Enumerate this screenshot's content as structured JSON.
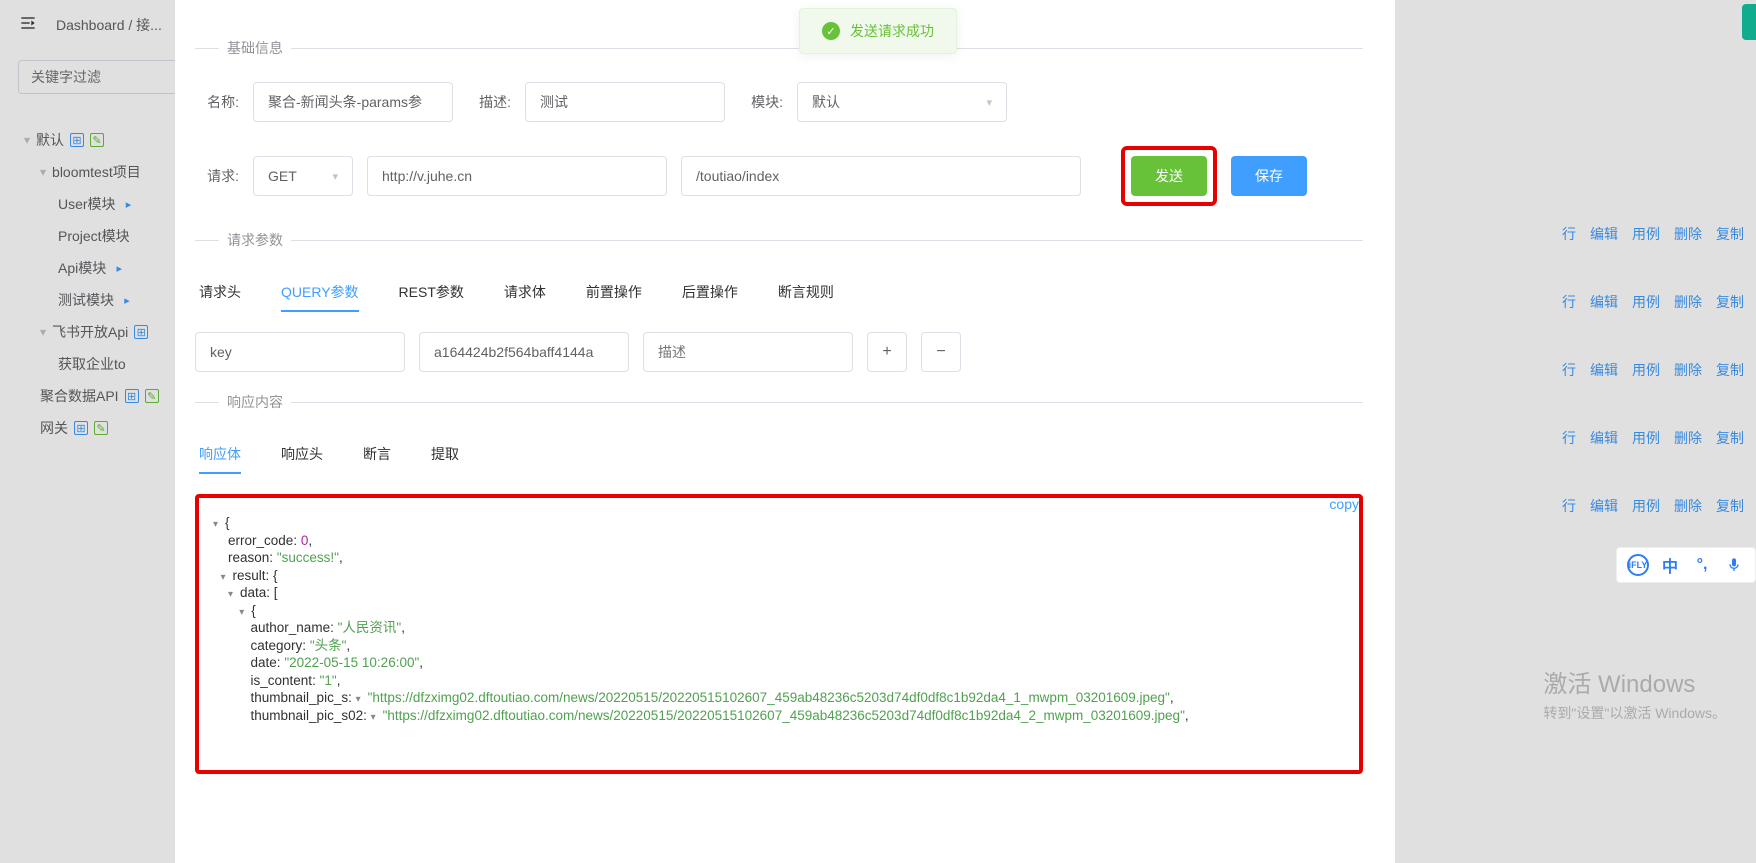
{
  "breadcrumb": {
    "items": [
      "Dashboard",
      "接..."
    ]
  },
  "sidebar": {
    "filter_placeholder": "关键字过滤",
    "nodes": [
      {
        "level": 1,
        "label": "默认",
        "open": true,
        "icons": [
          "folder-add",
          "doc-add"
        ]
      },
      {
        "level": 2,
        "label": "bloomtest项目",
        "open": true
      },
      {
        "level": 3,
        "label": "User模块",
        "icons": [
          "folder"
        ]
      },
      {
        "level": 3,
        "label": "Project模块"
      },
      {
        "level": 3,
        "label": "Api模块",
        "icons": [
          "folder"
        ]
      },
      {
        "level": 3,
        "label": "测试模块",
        "icons": [
          "folder"
        ]
      },
      {
        "level": 2,
        "label": "飞书开放Api",
        "open": true,
        "icons": [
          "folder-add"
        ]
      },
      {
        "level": 3,
        "label": "获取企业to"
      },
      {
        "level": 2,
        "label": "聚合数据API",
        "icons": [
          "folder-add",
          "doc-add"
        ]
      },
      {
        "level": 2,
        "label": "网关",
        "icons": [
          "folder-add",
          "doc-add"
        ]
      }
    ]
  },
  "toast": {
    "message": "发送请求成功"
  },
  "modal": {
    "sections": {
      "basic": "基础信息",
      "params": "请求参数",
      "response": "响应内容"
    },
    "labels": {
      "name": "名称:",
      "desc": "描述:",
      "module": "模块:",
      "request": "请求:"
    },
    "name_value": "聚合-新闻头条-params参",
    "desc_value": "测试",
    "module_value": "默认",
    "method": "GET",
    "host": "http://v.juhe.cn",
    "path": "/toutiao/index",
    "buttons": {
      "send": "发送",
      "save": "保存"
    },
    "param_tabs": [
      "请求头",
      "QUERY参数",
      "REST参数",
      "请求体",
      "前置操作",
      "后置操作",
      "断言规则"
    ],
    "param_tab_active": 1,
    "query": {
      "key": "key",
      "value": "a164424b2f564baff4144a",
      "desc_placeholder": "描述"
    },
    "resp_tabs": [
      "响应体",
      "响应头",
      "断言",
      "提取"
    ],
    "resp_tab_active": 0,
    "copy_label": "copy",
    "response_json": {
      "error_code": 0,
      "reason": "success!",
      "result_data_0": {
        "author_name": "人民资讯",
        "category": "头条",
        "date": "2022-05-15 10:26:00",
        "is_content": "1",
        "thumbnail_pic_s": "https://dfzximg02.dftoutiao.com/news/20220515/20220515102607_459ab48236c5203d74df0df8c1b92da4_1_mwpm_03201609.jpeg",
        "thumbnail_pic_s02": "https://dfzximg02.dftoutiao.com/news/20220515/20220515102607_459ab48236c5203d74df0df8c1b92da4_2_mwpm_03201609.jpeg"
      }
    }
  },
  "right_actions": [
    "行",
    "编辑",
    "用例",
    "删除",
    "复制"
  ],
  "floatbar": {
    "lang": "中"
  },
  "watermark": {
    "line1": "激活 Windows",
    "line2": "转到\"设置\"以激活 Windows。"
  }
}
